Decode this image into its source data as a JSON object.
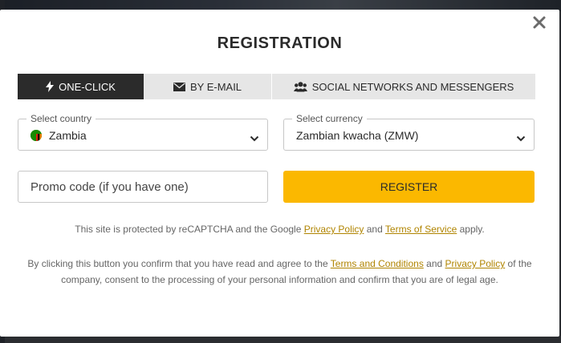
{
  "modal": {
    "title": "REGISTRATION"
  },
  "tabs": [
    {
      "label": "ONE-CLICK",
      "icon": "lightning-icon",
      "active": true
    },
    {
      "label": "BY E-MAIL",
      "icon": "envelope-icon",
      "active": false
    },
    {
      "label": "SOCIAL NETWORKS AND MESSENGERS",
      "icon": "users-icon",
      "active": false
    }
  ],
  "country": {
    "label": "Select country",
    "value": "Zambia",
    "flag": "zambia-flag-icon"
  },
  "currency": {
    "label": "Select currency",
    "value": "Zambian kwacha (ZMW)"
  },
  "promo": {
    "placeholder": "Promo code (if you have one)"
  },
  "register": {
    "label": "REGISTER"
  },
  "captcha": {
    "prefix": "This site is protected by reCAPTCHA and the Google ",
    "privacy_link": "Privacy Policy",
    "middle": " and ",
    "terms_link": "Terms of Service",
    "suffix": " apply."
  },
  "consent": {
    "prefix": "By clicking this button you confirm that you have read and agree to the ",
    "terms_link": "Terms and Conditions",
    "middle": " and ",
    "privacy_link": "Privacy Policy",
    "suffix": " of the company, consent to the processing of your personal information and confirm that you are of legal age."
  },
  "colors": {
    "accent": "#fbb800",
    "tab_active": "#2b2b2b",
    "link": "#b08400"
  }
}
